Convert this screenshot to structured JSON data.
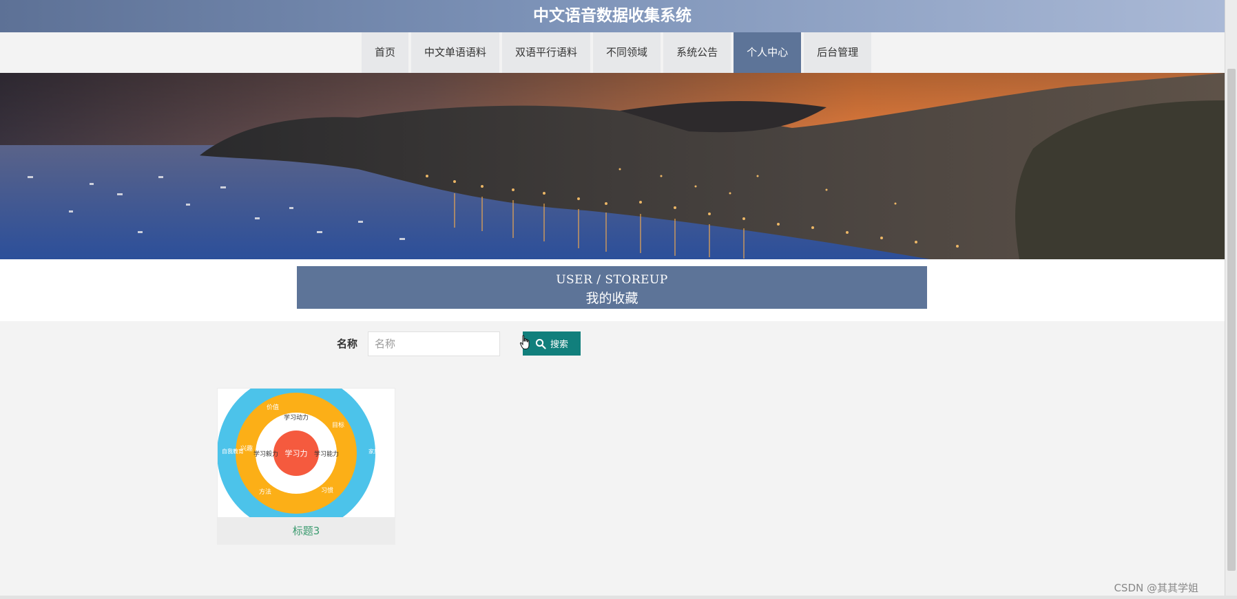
{
  "header": {
    "title": "中文语音数据收集系统"
  },
  "nav": {
    "items": [
      {
        "label": "首页"
      },
      {
        "label": "中文单语语料"
      },
      {
        "label": "双语平行语料"
      },
      {
        "label": "不同领域"
      },
      {
        "label": "系统公告"
      },
      {
        "label": "个人中心"
      },
      {
        "label": "后台管理"
      }
    ],
    "active": "个人中心"
  },
  "section": {
    "title_en": "USER / STOREUP",
    "title_cn": "我的收藏"
  },
  "search": {
    "label": "名称",
    "placeholder": "名称",
    "value": "",
    "button_label": "搜索",
    "button_icon": "search-icon"
  },
  "items": [
    {
      "title": "标题3",
      "image": {
        "center": "学习力",
        "inner": [
          "学习动力",
          "学习毅力",
          "学习能力"
        ],
        "middle": [
          "价值",
          "目标",
          "兴趣",
          "方法",
          "习惯"
        ],
        "outer": [
          "自我教育",
          "家庭教育"
        ]
      }
    }
  ],
  "colors": {
    "accent": "#5d7498",
    "button": "#117f7c",
    "card_title": "#3a9a6e"
  },
  "watermark": "CSDN @其其学姐"
}
